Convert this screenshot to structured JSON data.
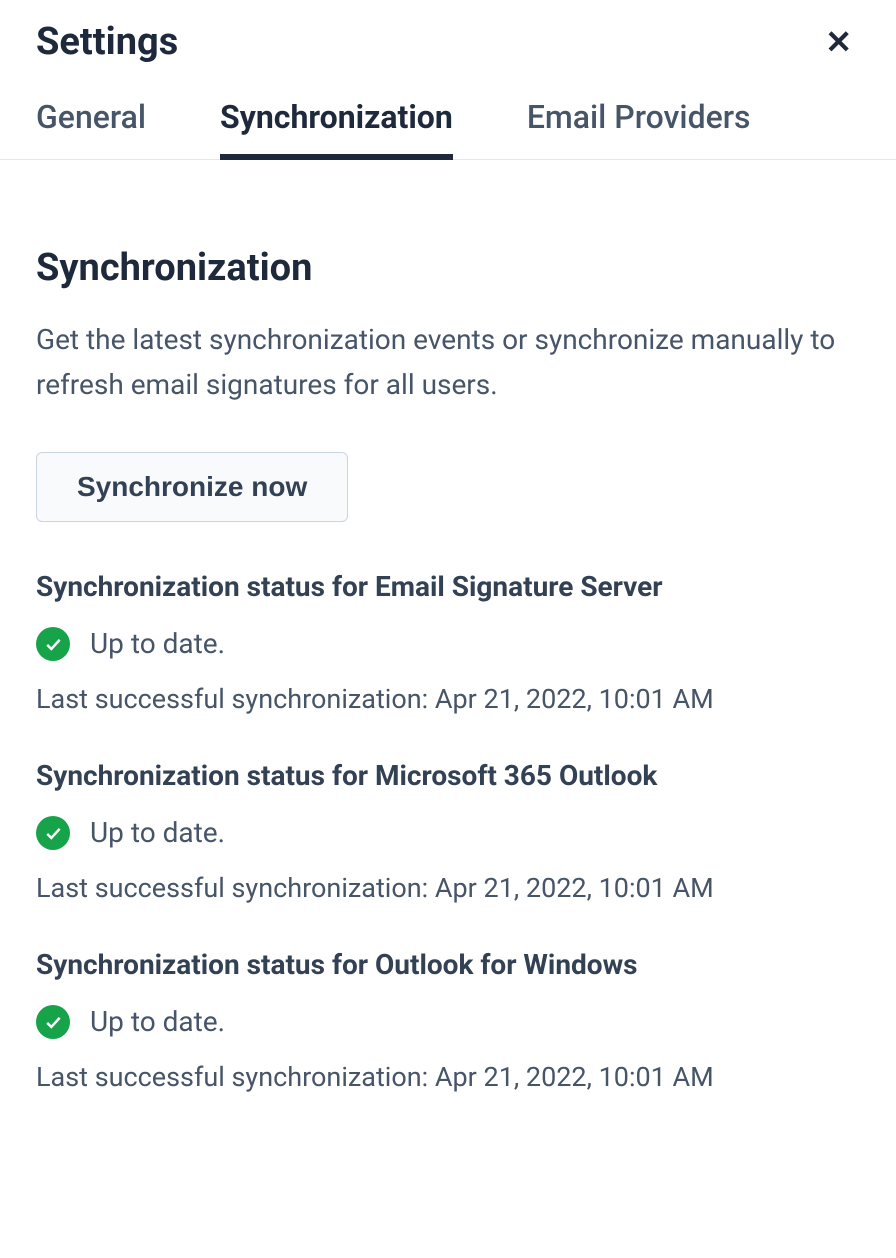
{
  "header": {
    "title": "Settings"
  },
  "tabs": {
    "general": "General",
    "synchronization": "Synchronization",
    "emailProviders": "Email Providers"
  },
  "section": {
    "title": "Synchronization",
    "description": "Get the latest synchronization events or synchronize manually to refresh email signatures for all users.",
    "syncButton": "Synchronize now"
  },
  "statuses": [
    {
      "title": "Synchronization status for Email Signature Server",
      "status": "Up to date.",
      "meta": "Last successful synchronization: Apr 21, 2022, 10:01 AM"
    },
    {
      "title": "Synchronization status for Microsoft 365 Outlook",
      "status": "Up to date.",
      "meta": "Last successful synchronization: Apr 21, 2022, 10:01 AM"
    },
    {
      "title": "Synchronization status for Outlook for Windows",
      "status": "Up to date.",
      "meta": "Last successful synchronization: Apr 21, 2022, 10:01 AM"
    }
  ]
}
